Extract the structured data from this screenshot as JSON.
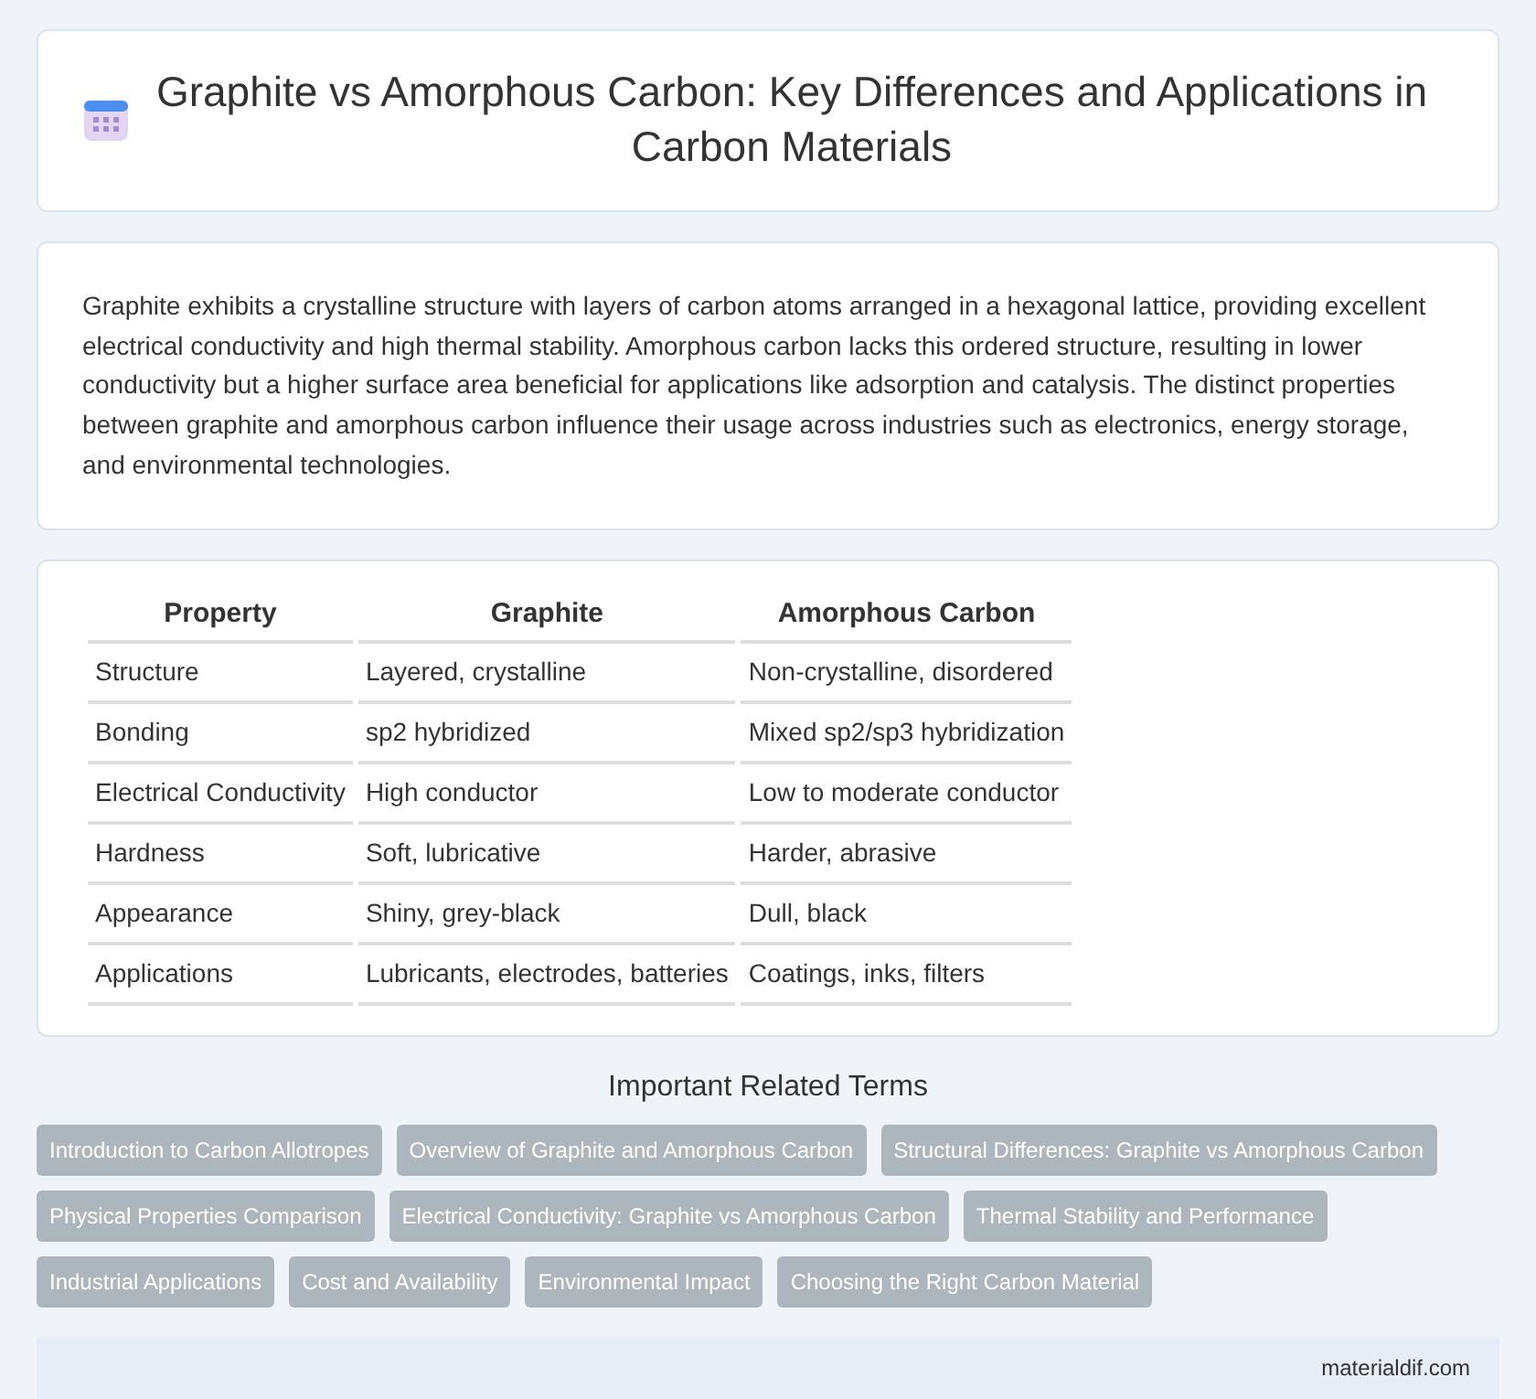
{
  "header": {
    "title": "Graphite vs Amorphous Carbon: Key Differences and Applications in Carbon Materials"
  },
  "intro": "Graphite exhibits a crystalline structure with layers of carbon atoms arranged in a hexagonal lattice, providing excellent electrical conductivity and high thermal stability. Amorphous carbon lacks this ordered structure, resulting in lower conductivity but a higher surface area beneficial for applications like adsorption and catalysis. The distinct properties between graphite and amorphous carbon influence their usage across industries such as electronics, energy storage, and environmental technologies.",
  "table": {
    "columns": [
      "Property",
      "Graphite",
      "Amorphous Carbon"
    ],
    "rows": [
      [
        "Structure",
        "Layered, crystalline",
        "Non-crystalline, disordered"
      ],
      [
        "Bonding",
        "sp2 hybridized",
        "Mixed sp2/sp3 hybridization"
      ],
      [
        "Electrical Conductivity",
        "High conductor",
        "Low to moderate conductor"
      ],
      [
        "Hardness",
        "Soft, lubricative",
        "Harder, abrasive"
      ],
      [
        "Appearance",
        "Shiny, grey-black",
        "Dull, black"
      ],
      [
        "Applications",
        "Lubricants, electrodes, batteries",
        "Coatings, inks, filters"
      ]
    ]
  },
  "related": {
    "title": "Important Related Terms",
    "tags": [
      "Introduction to Carbon Allotropes",
      "Overview of Graphite and Amorphous Carbon",
      "Structural Differences: Graphite vs Amorphous Carbon",
      "Physical Properties Comparison",
      "Electrical Conductivity: Graphite vs Amorphous Carbon",
      "Thermal Stability and Performance",
      "Industrial Applications",
      "Cost and Availability",
      "Environmental Impact",
      "Choosing the Right Carbon Material"
    ]
  },
  "footer": "materialdif.com"
}
